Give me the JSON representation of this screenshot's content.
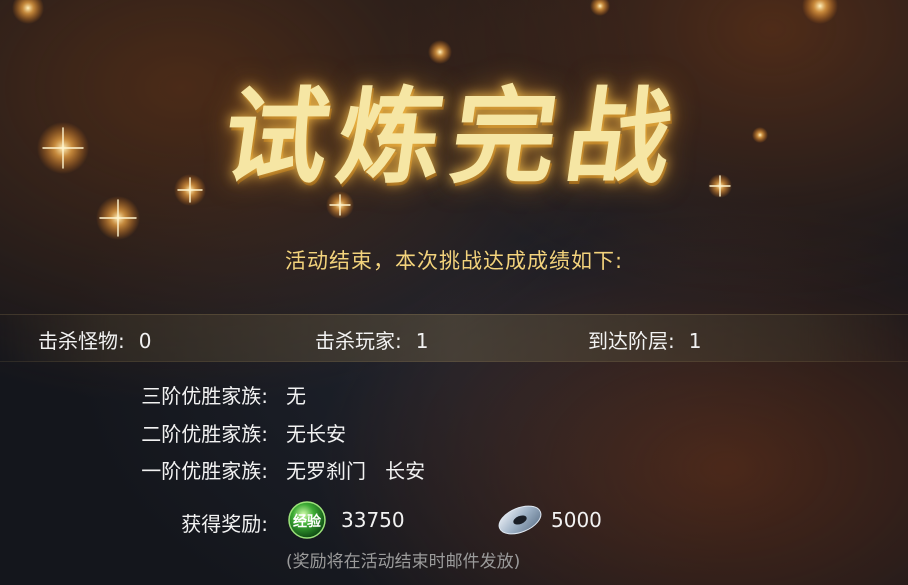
{
  "banner": {
    "title": "试炼完战"
  },
  "summary": {
    "subtitle": "活动结束，本次挑战达成成绩如下:"
  },
  "stats": {
    "monsters_label": "击杀怪物:",
    "monsters_value": "0",
    "players_label": "击杀玩家:",
    "players_value": "1",
    "floor_label": "到达阶层:",
    "floor_value": "1"
  },
  "families": [
    {
      "label": "三阶优胜家族:",
      "value": "无"
    },
    {
      "label": "二阶优胜家族:",
      "value": "无长安"
    },
    {
      "label": "一阶优胜家族:",
      "value": "无罗刹门   长安"
    }
  ],
  "rewards": {
    "label": "获得奖励:",
    "exp": {
      "icon": "exp-orb-icon",
      "icon_text": "经验",
      "value": "33750"
    },
    "coin": {
      "icon": "silver-coin-icon",
      "value": "5000"
    },
    "note": "(奖励将在活动结束时邮件发放)"
  },
  "colors": {
    "title": "#f6e6a4",
    "subtitle": "#f3d37c",
    "text": "#f2f2f2",
    "note": "#9b9b9b"
  }
}
